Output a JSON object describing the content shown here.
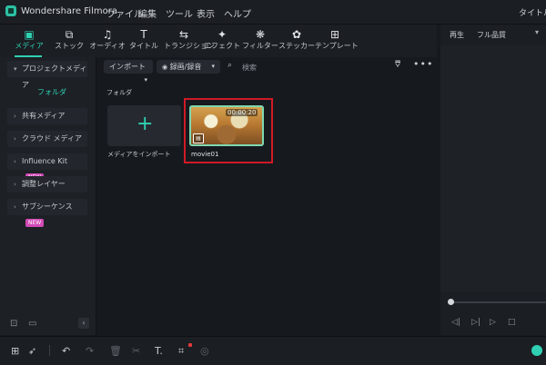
{
  "app": {
    "title": "Wondershare Filmora",
    "right_title": "タイトルな"
  },
  "menu": [
    "ファイル",
    "編集",
    "ツール",
    "表示",
    "ヘルプ"
  ],
  "toolbar": {
    "active_index": 0,
    "accent_color": "#2fd1b2",
    "items": [
      {
        "label": "メディア",
        "icon": "media-folder-icon"
      },
      {
        "label": "ストック",
        "icon": "stock-icon"
      },
      {
        "label": "オーディオ",
        "icon": "audio-note-icon"
      },
      {
        "label": "タイトル",
        "icon": "title-t-icon"
      },
      {
        "label": "トランジション",
        "icon": "transition-icon"
      },
      {
        "label": "エフェクト",
        "icon": "effect-sparkle-icon"
      },
      {
        "label": "フィルター",
        "icon": "filter-icon"
      },
      {
        "label": "ステッカー",
        "icon": "sticker-icon"
      },
      {
        "label": "テンプレート",
        "icon": "template-icon"
      }
    ]
  },
  "sidebar": {
    "items": [
      {
        "label": "プロジェクトメディア",
        "expanded": true
      },
      {
        "label": "共有メディア",
        "expanded": false
      },
      {
        "label": "クラウド メディア",
        "expanded": false
      },
      {
        "label": "Influence Kit",
        "badge": "NEW",
        "expanded": false
      },
      {
        "label": "調整レイヤー",
        "expanded": false
      },
      {
        "label": "サブシーケンス",
        "badge": "NEW",
        "expanded": false
      }
    ],
    "folder_sub": "フォルダ",
    "badge_color": "#d24ab6"
  },
  "media_toolbar": {
    "import_label": "インポート",
    "record_label": "録画/録音",
    "search_placeholder": "検索"
  },
  "media": {
    "folder_label": "フォルダ",
    "import_card_label": "メディアをインポート",
    "clip": {
      "name": "movie01",
      "duration": "00:00:20"
    },
    "highlight_color": "#d01a26"
  },
  "preview": {
    "tab_play": "再生",
    "quality": "フル品質",
    "progress": 0.0
  }
}
